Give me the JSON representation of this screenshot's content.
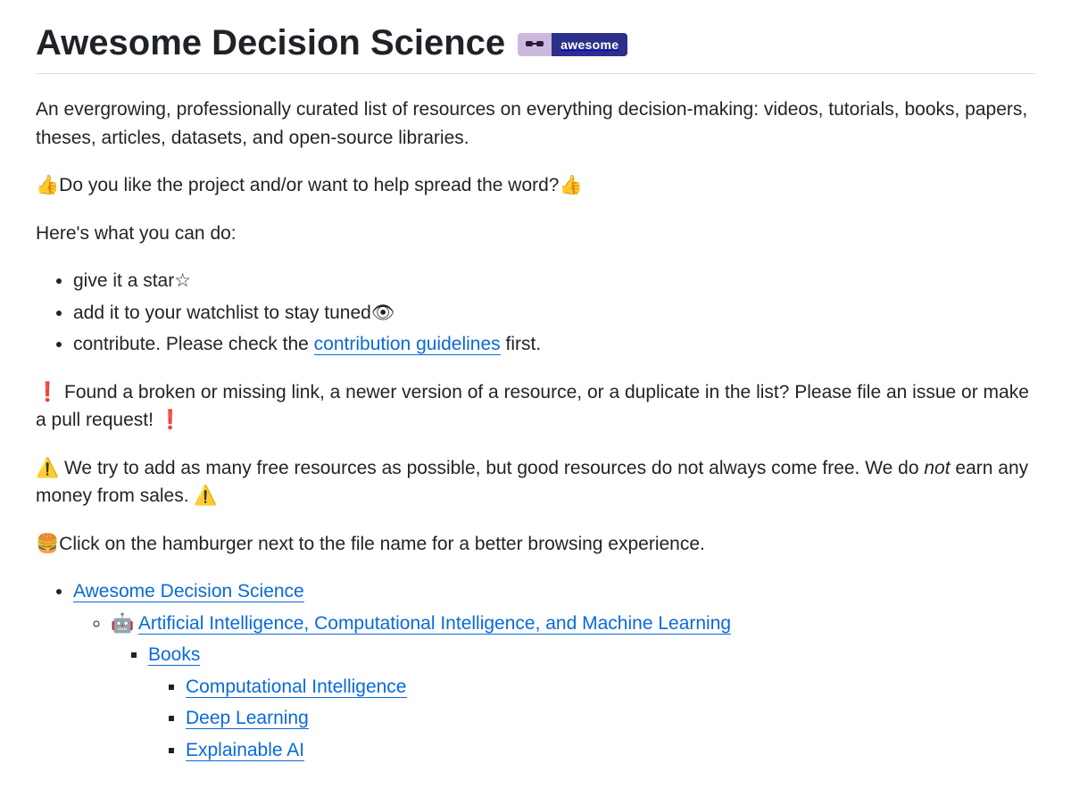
{
  "header": {
    "title": "Awesome Decision Science",
    "badge_text": "awesome"
  },
  "intro": "An evergrowing, professionally curated list of resources on everything decision-making: videos, tutorials, books, papers, theses, articles, datasets, and open-source libraries.",
  "like_line": {
    "emoji": "👍",
    "text": "Do you like the project and/or want to help spread the word?"
  },
  "what_you_can_do_label": "Here's what you can do:",
  "actions": {
    "star": {
      "text": "give it a star",
      "emoji": "☆"
    },
    "watch": {
      "text": "add it to your watchlist to stay tuned",
      "emoji": "👁"
    },
    "contribute": {
      "prefix": "contribute. Please check the ",
      "link": "contribution guidelines",
      "suffix": " first."
    }
  },
  "broken_link": {
    "emoji": "❗",
    "text": " Found a broken or missing link, a newer version of a resource, or a duplicate in the list? Please file an issue or make a pull request! "
  },
  "warning": {
    "emoji": "⚠️",
    "prefix": " We try to add as many free resources as possible, but good resources do not always come free. We do ",
    "em": "not",
    "suffix": " earn any money from sales. "
  },
  "hamburger": {
    "emoji": "🍔",
    "text": "Click on the hamburger next to the file name for a better browsing experience."
  },
  "toc": {
    "root": "Awesome Decision Science",
    "section_emoji": "🤖",
    "section": "Artificial Intelligence, Computational Intelligence, and Machine Learning",
    "books": "Books",
    "items": {
      "ci": "Computational Intelligence",
      "dl": "Deep Learning",
      "xai": "Explainable AI"
    }
  }
}
